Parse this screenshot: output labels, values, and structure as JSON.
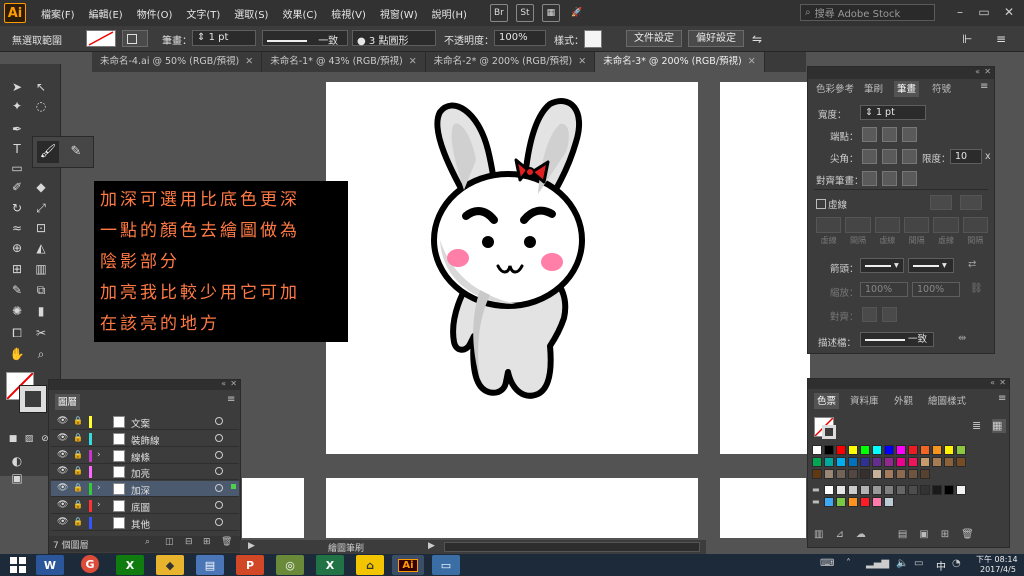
{
  "menubar": {
    "app_logo": "Ai",
    "items": [
      "檔案(F)",
      "編輯(E)",
      "物件(O)",
      "文字(T)",
      "選取(S)",
      "效果(C)",
      "檢視(V)",
      "視窗(W)",
      "說明(H)"
    ],
    "bridge_icon": "Br",
    "stock_icon": "St",
    "search_placeholder": "搜尋 Adobe Stock"
  },
  "controlbar": {
    "selection_state": "無選取範圍",
    "stroke_label": "筆畫：",
    "stroke_value": "1 pt",
    "profile_label": "一致",
    "brush_label": "3 點圓形",
    "opacity_label": "不透明度：",
    "opacity_value": "100%",
    "style_label": "樣式：",
    "doc_setup_button": "文件設定",
    "preferences_button": "偏好設定"
  },
  "tabs": [
    {
      "label": "未命名-4.ai @ 50% (RGB/預視)",
      "active": false
    },
    {
      "label": "未命名-1* @ 43% (RGB/預視)",
      "active": false
    },
    {
      "label": "未命名-2* @ 200% (RGB/預視)",
      "active": false
    },
    {
      "label": "未命名-3* @ 200% (RGB/預視)",
      "active": true
    }
  ],
  "note": {
    "lines": [
      "加深可選用比底色更深",
      "一點的顏色去繪圖做為",
      "陰影部分",
      "加亮我比較少用它可加",
      "在該亮的地方"
    ]
  },
  "stroke_panel": {
    "tabs": [
      "色彩參考",
      "筆刷",
      "筆畫",
      "符號"
    ],
    "active_tab": "筆畫",
    "weight_label": "寬度：",
    "weight_value": "1 pt",
    "cap_label": "端點：",
    "corner_label": "尖角：",
    "limit_label": "限度：",
    "limit_value": "10",
    "limit_unit": "x",
    "align_label": "對齊筆畫：",
    "dashed_label": "虛線",
    "dash_fields": [
      "虛線",
      "間隔",
      "虛線",
      "間隔",
      "虛線",
      "間隔"
    ],
    "arrowheads_label": "箭頭：",
    "scale_label": "縮放：",
    "scale_values": [
      "100%",
      "100%"
    ],
    "align_arrow_label": "對齊：",
    "profile_label": "描述檔：",
    "profile_value": "一致"
  },
  "swatches_panel": {
    "tabs": [
      "色票",
      "資料庫",
      "外觀",
      "繪圖樣式"
    ],
    "active_tab": "色票",
    "rows": [
      [
        "#ffffff",
        "#000000",
        "#ff0000",
        "#ffff00",
        "#00ff00",
        "#00ffff",
        "#0000ff",
        "#ff00ff",
        "#ed1c24",
        "#f26522",
        "#f7941d",
        "#fff200",
        "#8dc63f"
      ],
      [
        "#00a651",
        "#00a99d",
        "#00aeef",
        "#0072bc",
        "#2e3192",
        "#662d91",
        "#92278f",
        "#ec008c",
        "#ed145b",
        "#c69c6d",
        "#a67c52",
        "#8c6239",
        "#754c24"
      ],
      [
        "#603913",
        "#998675",
        "#736357",
        "#534741",
        "#362f2d",
        "#c7b299",
        "#a37b5c",
        "#8b6a4f",
        "#6f5440",
        "#57412f"
      ],
      [
        "#ffffff",
        "#e6e6e6",
        "#cccccc",
        "#b3b3b3",
        "#999999",
        "#808080",
        "#666666",
        "#4d4d4d",
        "#333333",
        "#1a1a1a",
        "#000000",
        "#f2f2f2"
      ],
      [
        "#3fa9f5",
        "#7ac943",
        "#ff931e",
        "#ff1d25",
        "#ff7bac",
        "#bdccd4"
      ]
    ]
  },
  "layers_panel": {
    "title": "圖層",
    "layers": [
      {
        "name": "文案",
        "color": "#ffff33",
        "selected": false,
        "expand": false
      },
      {
        "name": "裝飾線",
        "color": "#33dddd",
        "selected": false,
        "expand": false
      },
      {
        "name": "線條",
        "color": "#cc33cc",
        "selected": false,
        "expand": true
      },
      {
        "name": "加亮",
        "color": "#ff66ff",
        "selected": false,
        "expand": false
      },
      {
        "name": "加深",
        "color": "#33cc33",
        "selected": true,
        "expand": true
      },
      {
        "name": "底圖",
        "color": "#ff3333",
        "selected": false,
        "expand": true
      },
      {
        "name": "其他",
        "color": "#3355ff",
        "selected": false,
        "expand": false
      }
    ],
    "footer_count": "7 個圖層"
  },
  "statusbar": {
    "tool_name": "繪圖筆刷"
  },
  "taskbar": {
    "apps": [
      "W",
      "G",
      "X",
      "◆",
      "▤",
      "P",
      "◎",
      "X",
      "⌂",
      "Ai",
      "▭"
    ],
    "clock_time": "下午 08:14",
    "clock_date": "2017/4/5",
    "ime": "中"
  }
}
